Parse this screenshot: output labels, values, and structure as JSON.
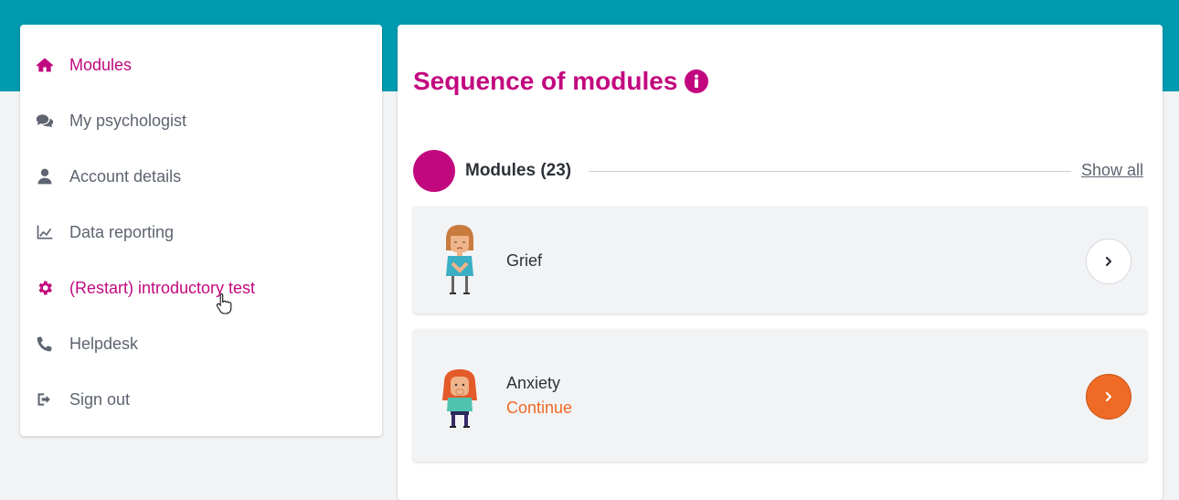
{
  "colors": {
    "topbar": "#009aaf",
    "accent": "#c2087f",
    "orange": "#ef6a24",
    "text": "#5e6470"
  },
  "sidebar": {
    "items": [
      {
        "label": "Modules",
        "icon": "home-icon",
        "active": true
      },
      {
        "label": "My psychologist",
        "icon": "chat-bubbles-icon",
        "active": false
      },
      {
        "label": "Account details",
        "icon": "user-icon",
        "active": false
      },
      {
        "label": "Data reporting",
        "icon": "line-chart-icon",
        "active": false
      },
      {
        "label": "(Restart) introductory test",
        "icon": "gear-icon",
        "active": true
      },
      {
        "label": "Helpdesk",
        "icon": "phone-icon",
        "active": false
      },
      {
        "label": "Sign out",
        "icon": "sign-out-icon",
        "active": false
      }
    ]
  },
  "main": {
    "title": "Sequence of modules",
    "section": {
      "title": "Modules (23)",
      "show_all": "Show all"
    },
    "modules": [
      {
        "name": "Grief",
        "status": "",
        "button": "outline",
        "avatar": "grief-character"
      },
      {
        "name": "Anxiety",
        "status": "Continue",
        "button": "filled",
        "avatar": "anxiety-character"
      }
    ]
  }
}
